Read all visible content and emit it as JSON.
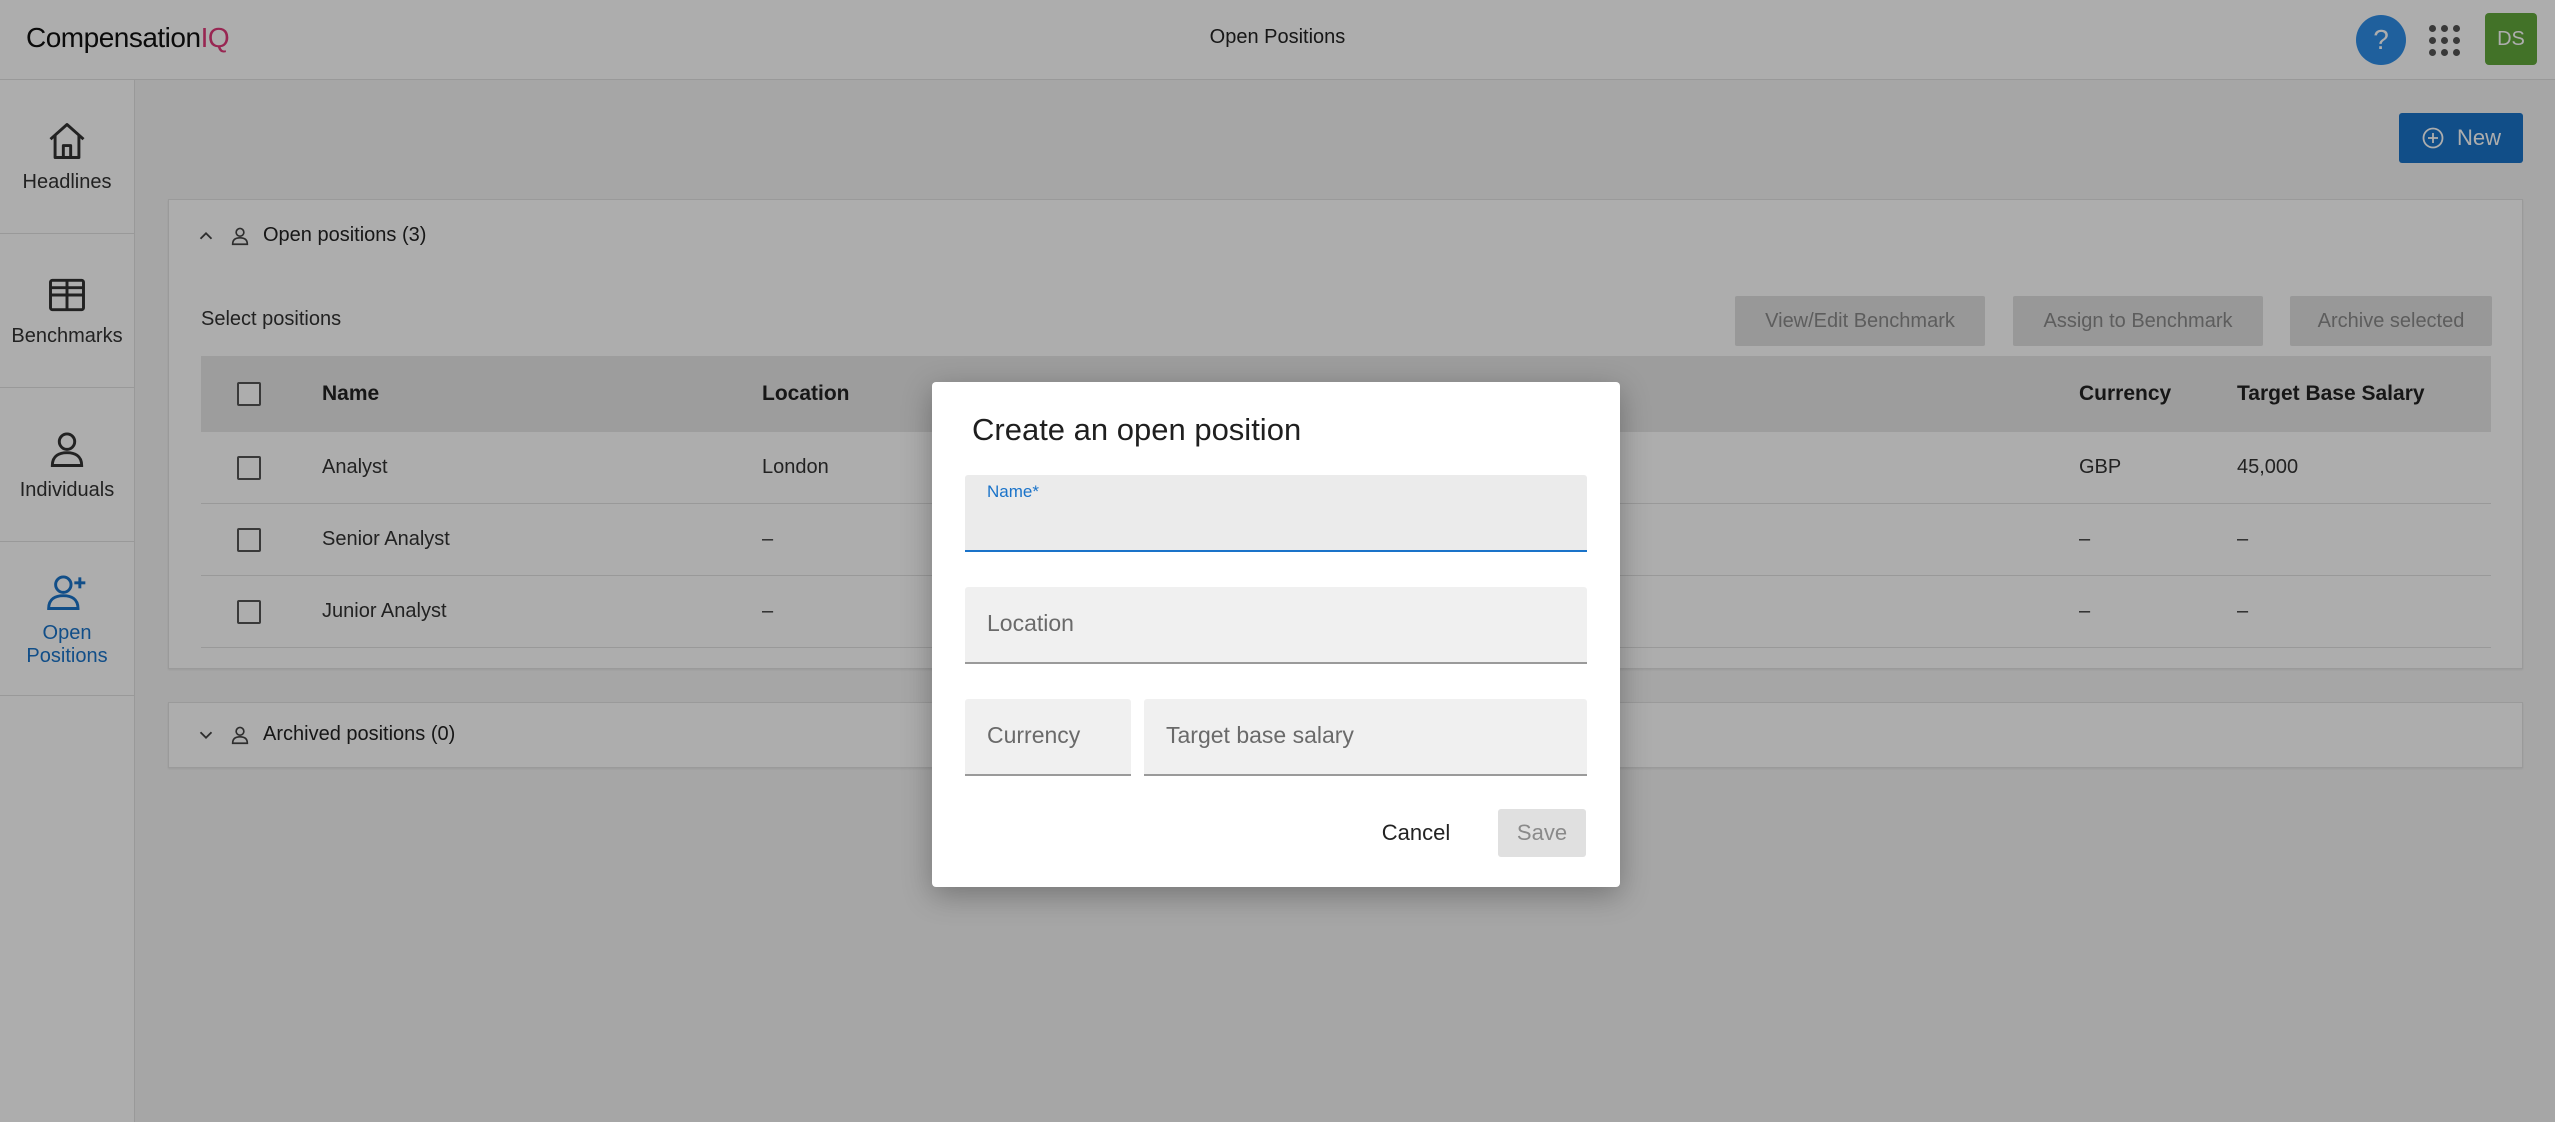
{
  "app": {
    "logo_text": "Compensation",
    "logo_accent": "IQ",
    "page_title": "Open Positions",
    "help_label": "?",
    "user_initials": "DS"
  },
  "sidebar": {
    "items": [
      {
        "label": "Headlines",
        "icon": "home-icon"
      },
      {
        "label": "Benchmarks",
        "icon": "table-icon"
      },
      {
        "label": "Individuals",
        "icon": "person-icon"
      },
      {
        "label": "Open Positions",
        "icon": "person-add-icon",
        "active": true
      }
    ]
  },
  "toolbar": {
    "new_label": "New"
  },
  "open_panel": {
    "header": "Open positions (3)",
    "select_label": "Select positions",
    "actions": {
      "view_edit": "View/Edit Benchmark",
      "assign": "Assign to Benchmark",
      "archive": "Archive selected"
    },
    "columns": {
      "name": "Name",
      "location": "Location",
      "currency": "Currency",
      "target": "Target Base Salary"
    },
    "rows": [
      {
        "name": "Analyst",
        "location": "London",
        "currency": "GBP",
        "target": "45,000"
      },
      {
        "name": "Senior Analyst",
        "location": "–",
        "currency": "–",
        "target": "–"
      },
      {
        "name": "Junior Analyst",
        "location": "–",
        "currency": "–",
        "target": "–"
      }
    ]
  },
  "archived_panel": {
    "header": "Archived positions (0)"
  },
  "modal": {
    "title": "Create an open position",
    "fields": {
      "name_label": "Name*",
      "name_value": "",
      "location_label": "Location",
      "currency_label": "Currency",
      "target_label": "Target base salary"
    },
    "cancel_label": "Cancel",
    "save_label": "Save"
  },
  "colors": {
    "primary": "#1a73c9",
    "help": "#2e8ee8",
    "avatar": "#62a83c",
    "logo_accent": "#e0397a"
  }
}
